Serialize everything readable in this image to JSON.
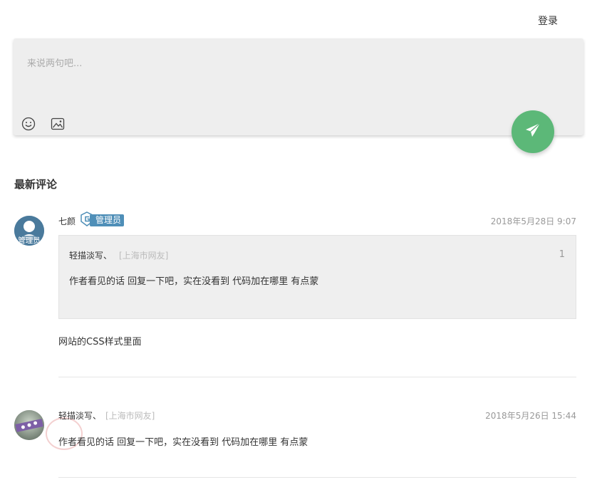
{
  "header": {
    "login_label": "登录"
  },
  "composer": {
    "placeholder": "来说两句吧...",
    "emoji_icon": "smile-icon",
    "image_icon": "image-icon",
    "send_icon": "paper-plane-icon",
    "send_color": "#5cb878"
  },
  "comments_section": {
    "title": "最新评论"
  },
  "comments": [
    {
      "author": "七颜",
      "badge": "管理员",
      "time": "2018年5月28日 9:07",
      "quote": {
        "author": "轻描淡写、",
        "location": "[上海市网友]",
        "floor": "1",
        "text": "作者看见的话 回复一下吧，实在没看到 代码加在哪里 有点蒙"
      },
      "body": "网站的CSS样式里面",
      "avatar_text": "管理员"
    },
    {
      "author": "轻描淡写、",
      "location": "[上海市网友]",
      "time": "2018年5月26日 15:44",
      "body": "作者看见的话 回复一下吧，实在没看到 代码加在哪里 有点蒙"
    }
  ],
  "colors": {
    "badge": "#4f8fb8",
    "accent": "#5cb878"
  }
}
